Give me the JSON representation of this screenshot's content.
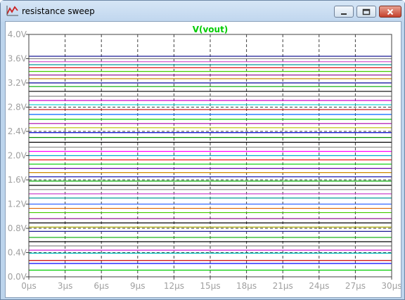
{
  "window": {
    "title": "resistance sweep"
  },
  "icons": {
    "app": "waveform-icon",
    "minimize": "minimize-icon",
    "maximize": "maximize-icon",
    "close": "close-icon"
  },
  "colors": {
    "trace_label": "#00cc00",
    "axis_text": "#a0a0a0",
    "grid": "#404040",
    "plot_border": "#404040"
  },
  "chart_data": {
    "type": "line",
    "title": "V(vout)",
    "x_ticks": [
      "0µs",
      "3µs",
      "6µs",
      "9µs",
      "12µs",
      "15µs",
      "18µs",
      "21µs",
      "24µs",
      "27µs",
      "30µs"
    ],
    "y_ticks": [
      "0.0V",
      "0.4V",
      "0.8V",
      "1.2V",
      "1.6V",
      "2.0V",
      "2.4V",
      "2.8V",
      "3.2V",
      "3.6V",
      "4.0V"
    ],
    "xlim": [
      0,
      30
    ],
    "ylim": [
      0,
      4
    ],
    "x_unit": "µs",
    "y_unit": "V",
    "grid": true,
    "series": [
      {
        "color": "#00cc00",
        "values": [
          0.11,
          0.11
        ]
      },
      {
        "color": "#0000ff",
        "values": [
          0.22,
          0.22
        ]
      },
      {
        "color": "#cc0000",
        "values": [
          0.27,
          0.27
        ]
      },
      {
        "color": "#00bbbb",
        "values": [
          0.39,
          0.39
        ]
      },
      {
        "color": "#cc00cc",
        "values": [
          0.44,
          0.44
        ]
      },
      {
        "color": "#888888",
        "values": [
          0.51,
          0.51
        ]
      },
      {
        "color": "#000000",
        "values": [
          0.58,
          0.58
        ]
      },
      {
        "color": "#00aa00",
        "values": [
          0.65,
          0.65
        ]
      },
      {
        "color": "#000088",
        "values": [
          0.75,
          0.75
        ]
      },
      {
        "color": "#aaaa00",
        "values": [
          0.82,
          0.82
        ]
      },
      {
        "color": "#000000",
        "values": [
          0.89,
          0.89
        ]
      },
      {
        "color": "#880088",
        "values": [
          0.96,
          0.96
        ]
      },
      {
        "color": "#44cc00",
        "values": [
          1.06,
          1.06
        ]
      },
      {
        "color": "#dd6600",
        "values": [
          1.13,
          1.13
        ]
      },
      {
        "color": "#3366ff",
        "values": [
          1.2,
          1.2
        ]
      },
      {
        "color": "#009999",
        "values": [
          1.3,
          1.3
        ]
      },
      {
        "color": "#cc44cc",
        "values": [
          1.37,
          1.37
        ]
      },
      {
        "color": "#888888",
        "values": [
          1.44,
          1.44
        ]
      },
      {
        "color": "#000000",
        "values": [
          1.51,
          1.51
        ]
      },
      {
        "color": "#00aa00",
        "values": [
          1.58,
          1.58
        ]
      },
      {
        "color": "#0000aa",
        "values": [
          1.65,
          1.65
        ]
      },
      {
        "color": "#cc8800",
        "values": [
          1.72,
          1.72
        ]
      },
      {
        "color": "#6600aa",
        "values": [
          1.79,
          1.79
        ]
      },
      {
        "color": "#00cc00",
        "values": [
          1.86,
          1.86
        ]
      },
      {
        "color": "#ee0000",
        "values": [
          1.93,
          1.93
        ]
      },
      {
        "color": "#00aacc",
        "values": [
          2.0,
          2.0
        ]
      },
      {
        "color": "#ff00ff",
        "values": [
          2.07,
          2.07
        ]
      },
      {
        "color": "#888888",
        "values": [
          2.14,
          2.14
        ]
      },
      {
        "color": "#000000",
        "values": [
          2.22,
          2.22
        ]
      },
      {
        "color": "#008800",
        "values": [
          2.3,
          2.3
        ]
      },
      {
        "color": "#0000cc",
        "values": [
          2.38,
          2.38
        ]
      },
      {
        "color": "#bbbb00",
        "values": [
          2.46,
          2.46
        ]
      },
      {
        "color": "#aa00aa",
        "values": [
          2.53,
          2.53
        ]
      },
      {
        "color": "#00cc00",
        "values": [
          2.6,
          2.6
        ]
      },
      {
        "color": "#0066ff",
        "values": [
          2.68,
          2.68
        ]
      },
      {
        "color": "#cc0000",
        "values": [
          2.76,
          2.76
        ]
      },
      {
        "color": "#00cccc",
        "values": [
          2.84,
          2.84
        ]
      },
      {
        "color": "#cc00cc",
        "values": [
          2.91,
          2.91
        ]
      },
      {
        "color": "#888888",
        "values": [
          2.98,
          2.98
        ]
      },
      {
        "color": "#000000",
        "values": [
          3.06,
          3.06
        ]
      },
      {
        "color": "#00aa00",
        "values": [
          3.14,
          3.14
        ]
      },
      {
        "color": "#000099",
        "values": [
          3.2,
          3.2
        ]
      },
      {
        "color": "#cc8800",
        "values": [
          3.27,
          3.27
        ]
      },
      {
        "color": "#880088",
        "values": [
          3.33,
          3.33
        ]
      },
      {
        "color": "#44cc00",
        "values": [
          3.39,
          3.39
        ]
      },
      {
        "color": "#dd0000",
        "values": [
          3.45,
          3.45
        ]
      },
      {
        "color": "#009999",
        "values": [
          3.5,
          3.5
        ]
      },
      {
        "color": "#cc44cc",
        "values": [
          3.55,
          3.55
        ]
      },
      {
        "color": "#888888",
        "values": [
          3.6,
          3.6
        ]
      },
      {
        "color": "#000088",
        "values": [
          3.64,
          3.64
        ]
      }
    ]
  }
}
